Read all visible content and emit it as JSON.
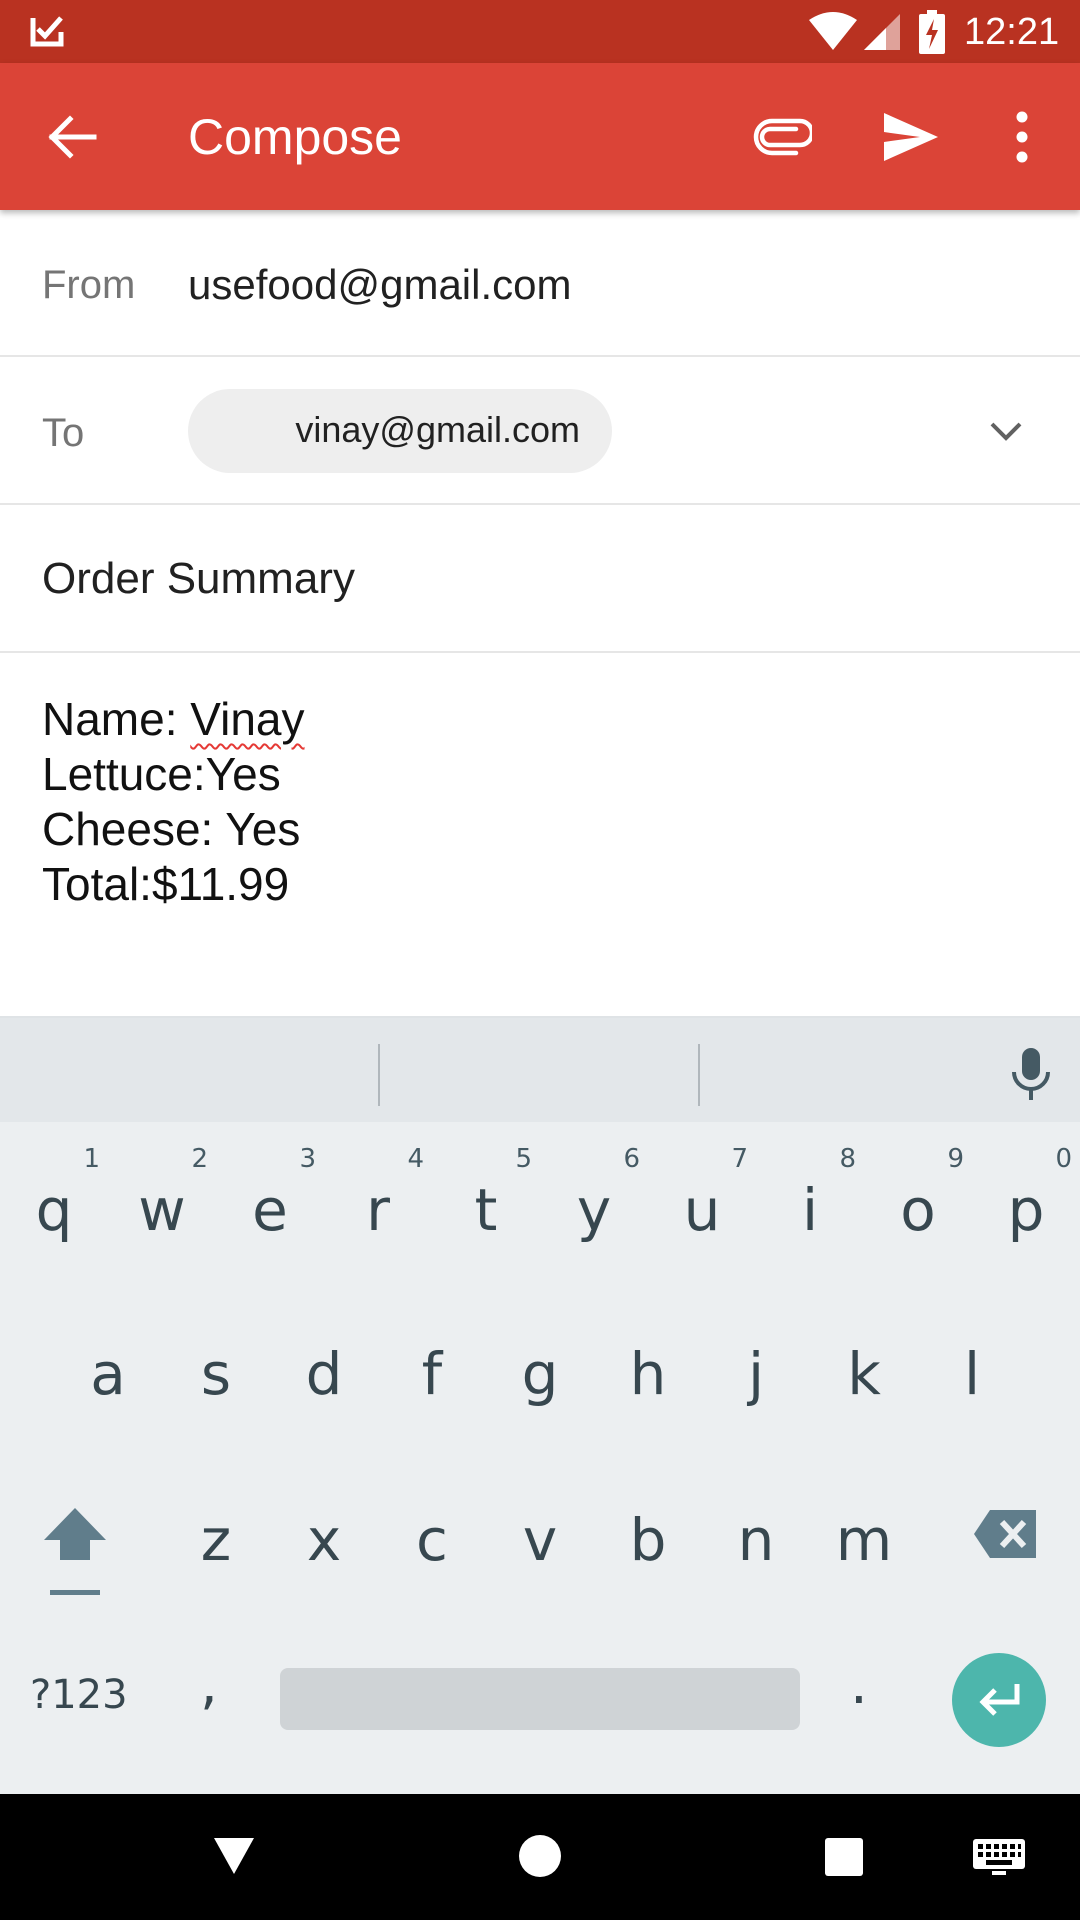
{
  "status_bar": {
    "time": "12:21",
    "icons": [
      "notification-check-icon",
      "wifi-icon",
      "cell-signal-icon",
      "battery-charging-icon"
    ]
  },
  "app_bar": {
    "title": "Compose",
    "actions": [
      "back-arrow-icon",
      "attach-icon",
      "send-icon",
      "more-vert-icon"
    ]
  },
  "compose": {
    "from_label": "From",
    "from_value": "usefood@gmail.com",
    "to_label": "To",
    "to_chip": "vinay@gmail.com",
    "subject": "Order Summary",
    "body": {
      "name_prefix": "Name: ",
      "name_value": "Vinay",
      "line2": "Lettuce:Yes",
      "line3": "Cheese: Yes",
      "line4": "Total:$11.99"
    }
  },
  "keyboard": {
    "row1": [
      {
        "k": "q",
        "n": "1"
      },
      {
        "k": "w",
        "n": "2"
      },
      {
        "k": "e",
        "n": "3"
      },
      {
        "k": "r",
        "n": "4"
      },
      {
        "k": "t",
        "n": "5"
      },
      {
        "k": "y",
        "n": "6"
      },
      {
        "k": "u",
        "n": "7"
      },
      {
        "k": "i",
        "n": "8"
      },
      {
        "k": "o",
        "n": "9"
      },
      {
        "k": "p",
        "n": "0"
      }
    ],
    "row2": [
      "a",
      "s",
      "d",
      "f",
      "g",
      "h",
      "j",
      "k",
      "l"
    ],
    "row3": [
      "z",
      "x",
      "c",
      "v",
      "b",
      "n",
      "m"
    ],
    "symbols_label": "?123",
    "comma": ",",
    "period": ".",
    "colors": {
      "enter": "#4db6ac",
      "background": "#eceff1"
    }
  },
  "colors": {
    "status_bar": "#b93221",
    "app_bar": "#db4437",
    "spellcheck": "#e53935"
  }
}
